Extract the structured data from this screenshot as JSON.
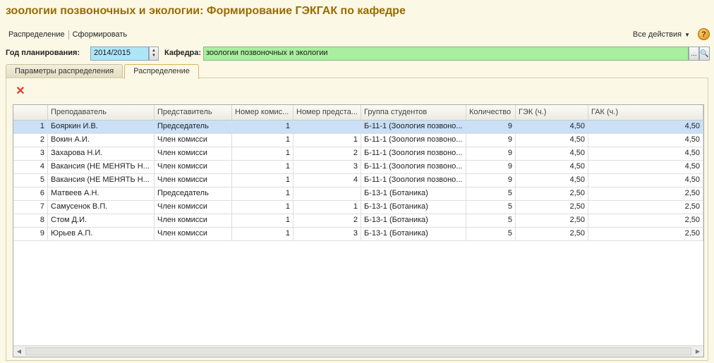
{
  "window": {
    "title": "зоологии позвоночных и экологии: Формирование ГЭКГАК по кафедре"
  },
  "toolbar": {
    "distribution": "Распределение",
    "generate": "Сформировать",
    "all_actions": "Все действия",
    "help": "?"
  },
  "filters": {
    "year_label": "Год планирования:",
    "year_value": "2014/2015",
    "dept_label": "Кафедра:",
    "dept_value": "зоологии позвоночных и экологии",
    "choose_btn": "...",
    "open_btn": "🔍"
  },
  "tabs": [
    "Параметры распределения",
    "Распределение"
  ],
  "active_tab": 1,
  "table": {
    "columns": [
      "",
      "Преподаватель",
      "Представитель",
      "Номер комис...",
      "Номер предста...",
      "Группа студентов",
      "Количество",
      "ГЭК (ч.)",
      "ГАК (ч.)"
    ],
    "rows": [
      [
        "1",
        "Бояркин И.В.",
        "Председатель",
        "1",
        "",
        "Б-11-1 (Зоология позвоно...",
        "9",
        "4,50",
        "4,50"
      ],
      [
        "2",
        "Вокин А.И.",
        "Член комисси",
        "1",
        "1",
        "Б-11-1 (Зоология позвоно...",
        "9",
        "4,50",
        "4,50"
      ],
      [
        "3",
        "Захарова Н.И.",
        "Член комисси",
        "1",
        "2",
        "Б-11-1 (Зоология позвоно...",
        "9",
        "4,50",
        "4,50"
      ],
      [
        "4",
        "Вакансия (НЕ МЕНЯТЬ Н...",
        "Член комисси",
        "1",
        "3",
        "Б-11-1 (Зоология позвоно...",
        "9",
        "4,50",
        "4,50"
      ],
      [
        "5",
        "Вакансия (НЕ МЕНЯТЬ Н...",
        "Член комисси",
        "1",
        "4",
        "Б-11-1 (Зоология позвоно...",
        "9",
        "4,50",
        "4,50"
      ],
      [
        "6",
        "Матвеев А.Н.",
        "Председатель",
        "1",
        "",
        "Б-13-1 (Ботаника)",
        "5",
        "2,50",
        "2,50"
      ],
      [
        "7",
        "Самусенок В.П.",
        "Член комисси",
        "1",
        "1",
        "Б-13-1 (Ботаника)",
        "5",
        "2,50",
        "2,50"
      ],
      [
        "8",
        "Стом Д.И.",
        "Член комисси",
        "1",
        "2",
        "Б-13-1 (Ботаника)",
        "5",
        "2,50",
        "2,50"
      ],
      [
        "9",
        "Юрьев А.П.",
        "Член комисси",
        "1",
        "3",
        "Б-13-1 (Ботаника)",
        "5",
        "2,50",
        "2,50"
      ]
    ],
    "selected_row": 0
  },
  "colors": {
    "title": "#9a6a00",
    "year_field": "#aee6f8",
    "dept_field": "#a8ef9e",
    "selection": "#c9e0f7"
  }
}
